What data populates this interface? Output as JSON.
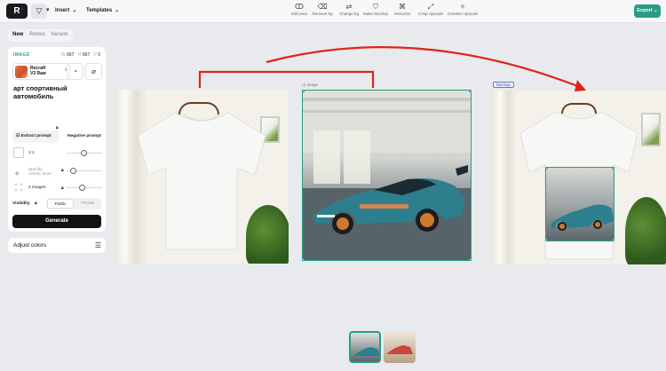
{
  "topbar": {
    "logo": "R",
    "menus": [
      {
        "label": "Insert"
      },
      {
        "label": "Templates"
      }
    ],
    "tools": [
      {
        "label": "Edit area",
        "icon": "lasso-icon"
      },
      {
        "label": "Remove bg",
        "icon": "eraser-icon"
      },
      {
        "label": "Change bg",
        "icon": "swap-icon"
      },
      {
        "label": "Make Mockup",
        "icon": "tshirt-icon"
      },
      {
        "label": "Vectorize",
        "icon": "vector-icon"
      },
      {
        "label": "Crisp Upscale",
        "icon": "upscale-icon"
      },
      {
        "label": "Creative Upscale",
        "icon": "sparkle-icon"
      }
    ],
    "export_label": "Export"
  },
  "tabs": [
    {
      "label": "New",
      "active": true
    },
    {
      "label": "Remix",
      "active": false
    },
    {
      "label": "Variate",
      "active": false
    }
  ],
  "panel": {
    "section_label": "IMAGE",
    "width_key": "W",
    "width": "667",
    "height_key": "H",
    "height": "667",
    "other_key": "P",
    "other": "0",
    "model_name_line1": "Recraft",
    "model_name_line2": "V3 Raw",
    "prompt": "арт спортивный автомобиль",
    "extract_label": "Extract prompt",
    "negative_label": "Negative prompt",
    "aspect_label": "1:1",
    "artistic_label_line1": "Specify",
    "artistic_label_line2": "Artistic level",
    "images_label": "2 images",
    "visibility_label": "Visibility",
    "public_label": "Public",
    "private_label": "Private",
    "generate_label": "Generate",
    "adjust_label": "Adjust colors"
  },
  "canvas": {
    "image_frame_label": "Image",
    "mockup_label": "Mockup",
    "arrow_color": "#e0241b",
    "selection_color": "#2a9c83"
  },
  "colors": {
    "accent": "#2a9c83",
    "background": "#e9eaee",
    "panel": "#ffffff"
  }
}
